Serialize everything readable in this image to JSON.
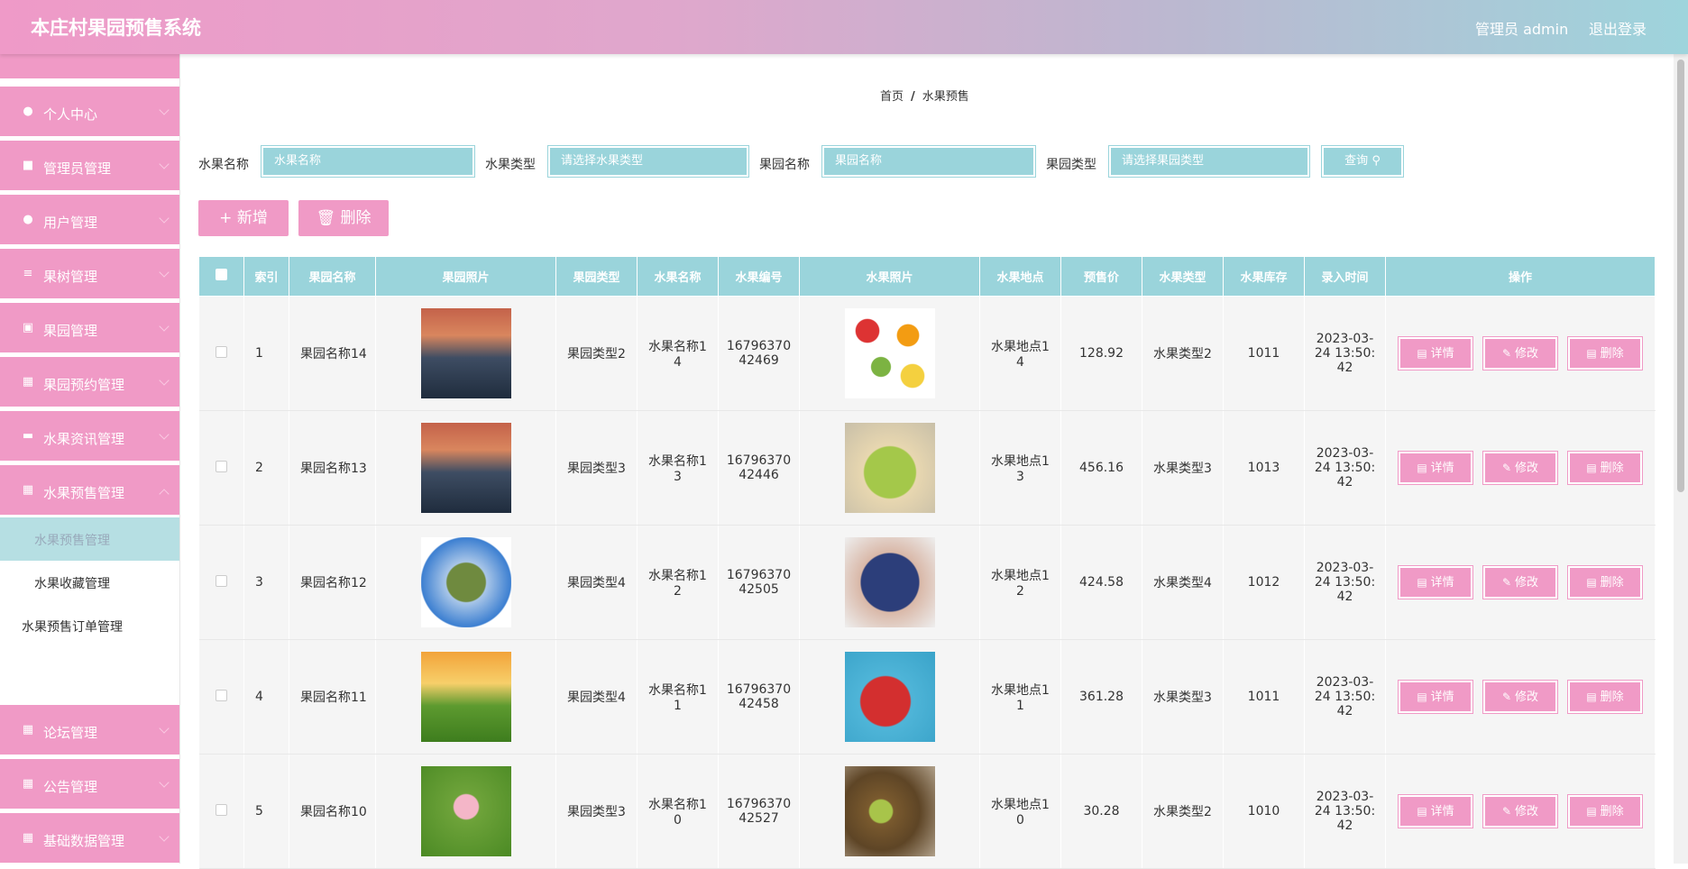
{
  "header": {
    "title": "本庄村果园预售系统",
    "admin": "管理员 admin",
    "logout": "退出登录"
  },
  "sidebar": {
    "items": [
      {
        "label": "个人中心",
        "icon": "user-icon"
      },
      {
        "label": "管理员管理",
        "icon": "briefcase-icon"
      },
      {
        "label": "用户管理",
        "icon": "user-icon"
      },
      {
        "label": "果树管理",
        "icon": "list-icon"
      },
      {
        "label": "果园管理",
        "icon": "clipboard-icon"
      },
      {
        "label": "果园预约管理",
        "icon": "grid-icon"
      },
      {
        "label": "水果资讯管理",
        "icon": "chat-icon"
      },
      {
        "label": "水果预售管理",
        "icon": "grid-icon"
      },
      {
        "label": "论坛管理",
        "icon": "grid-icon"
      },
      {
        "label": "公告管理",
        "icon": "grid-icon"
      },
      {
        "label": "基础数据管理",
        "icon": "grid-icon"
      }
    ],
    "subitems": [
      {
        "label": "水果预售管理",
        "active": true
      },
      {
        "label": "水果收藏管理",
        "active": false
      },
      {
        "label": "水果预售订单管理",
        "active": false
      }
    ]
  },
  "breadcrumb": {
    "home": "首页",
    "sep": "/",
    "current": "水果预售"
  },
  "search": {
    "fields": [
      {
        "label": "水果名称",
        "placeholder": "水果名称"
      },
      {
        "label": "水果类型",
        "placeholder": "请选择水果类型"
      },
      {
        "label": "果园名称",
        "placeholder": "果园名称"
      },
      {
        "label": "果园类型",
        "placeholder": "请选择果园类型"
      }
    ],
    "button": "查询"
  },
  "actions": {
    "add": "新增",
    "delete": "删除"
  },
  "table": {
    "headers": [
      "索引",
      "果园名称",
      "果园照片",
      "果园类型",
      "水果名称",
      "水果编号",
      "水果照片",
      "水果地点",
      "预售价",
      "水果类型",
      "水果库存",
      "录入时间",
      "操作"
    ],
    "op_labels": {
      "detail": "详情",
      "edit": "修改",
      "delete": "删除"
    },
    "rows": [
      {
        "index": "1",
        "orchard": "果园名称14",
        "orchard_type": "果园类型2",
        "fruit": "水果名称14",
        "code": "1679637042469",
        "place": "水果地点14",
        "price": "128.92",
        "fruit_type": "水果类型2",
        "stock": "1011",
        "time": "2023-03-24 13:50:42",
        "orchard_img": "sunset-lake",
        "fruit_img": "mixed-fruits"
      },
      {
        "index": "2",
        "orchard": "果园名称13",
        "orchard_type": "果园类型3",
        "fruit": "水果名称13",
        "code": "1679637042446",
        "place": "水果地点13",
        "price": "456.16",
        "fruit_type": "水果类型3",
        "stock": "1013",
        "time": "2023-03-24 13:50:42",
        "orchard_img": "sunset-lake",
        "fruit_img": "green-grapes"
      },
      {
        "index": "3",
        "orchard": "果园名称12",
        "orchard_type": "果园类型4",
        "fruit": "水果名称12",
        "code": "1679637042505",
        "place": "水果地点12",
        "price": "424.58",
        "fruit_type": "水果类型4",
        "stock": "1012",
        "time": "2023-03-24 13:50:42",
        "orchard_img": "tiny-planet",
        "fruit_img": "blueberries"
      },
      {
        "index": "4",
        "orchard": "果园名称11",
        "orchard_type": "果园类型4",
        "fruit": "水果名称11",
        "code": "1679637042458",
        "place": "水果地点11",
        "price": "361.28",
        "fruit_type": "水果类型3",
        "stock": "1011",
        "time": "2023-03-24 13:50:42",
        "orchard_img": "flower-meadow",
        "fruit_img": "strawberries"
      },
      {
        "index": "5",
        "orchard": "果园名称10",
        "orchard_type": "果园类型3",
        "fruit": "水果名称10",
        "code": "1679637042527",
        "place": "水果地点10",
        "price": "30.28",
        "fruit_type": "水果类型2",
        "stock": "1010",
        "time": "2023-03-24 13:50:42",
        "orchard_img": "lotus",
        "fruit_img": "kiwis"
      }
    ]
  }
}
